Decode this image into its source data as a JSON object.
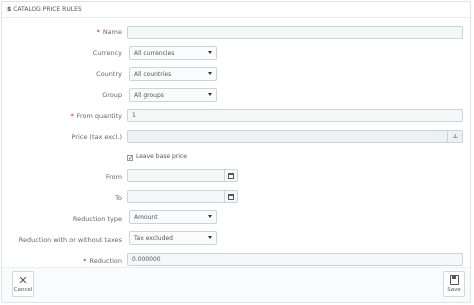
{
  "panel": {
    "title": "CATALOG PRICE RULES",
    "title_icon": "dollar-icon"
  },
  "form": {
    "name": {
      "label": "Name",
      "required": true,
      "value": ""
    },
    "currency": {
      "label": "Currency",
      "selected": "All currencies"
    },
    "country": {
      "label": "Country",
      "selected": "All countries"
    },
    "group": {
      "label": "Group",
      "selected": "All groups"
    },
    "from_quantity": {
      "label": "From quantity",
      "required": true,
      "value": "1"
    },
    "price": {
      "label": "Price (tax excl.)",
      "value": "",
      "currency_symbol": "بك"
    },
    "leave_base_price": {
      "label": "Leave base price",
      "checked": true
    },
    "from": {
      "label": "From",
      "value": ""
    },
    "to": {
      "label": "To",
      "value": ""
    },
    "reduction_type": {
      "label": "Reduction type",
      "selected": "Amount"
    },
    "reduction_tax": {
      "label": "Reduction with or without taxes",
      "selected": "Tax excluded"
    },
    "reduction": {
      "label": "Reduction",
      "required": true,
      "value": "0.000000"
    }
  },
  "footer": {
    "cancel_label": "Cancel",
    "save_label": "Save"
  }
}
